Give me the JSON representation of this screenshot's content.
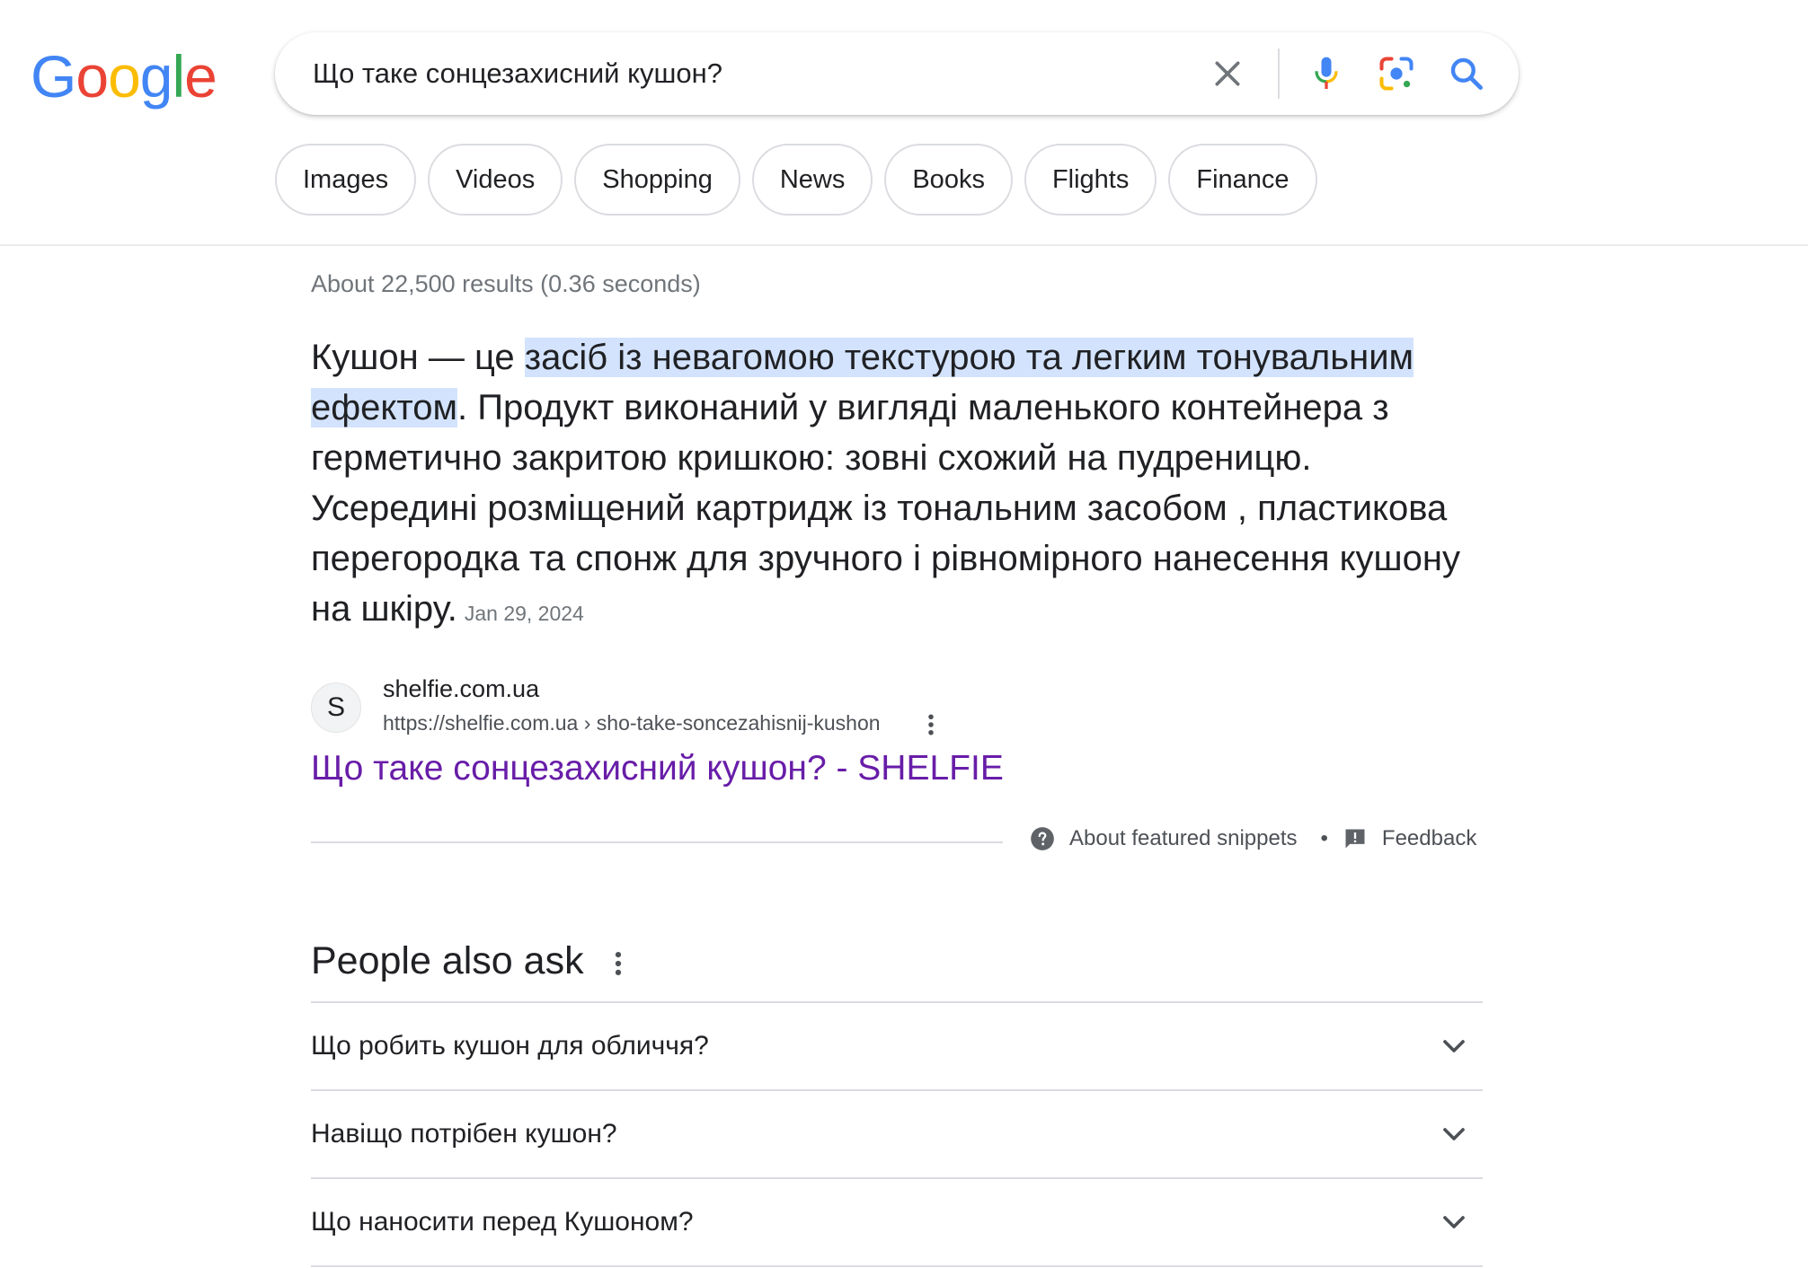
{
  "logo": {
    "letters": [
      "G",
      "o",
      "o",
      "g",
      "l",
      "e"
    ]
  },
  "search": {
    "query": "Що таке сонцезахисний кушон?",
    "icons": [
      "close-icon",
      "mic-icon",
      "lens-icon",
      "search-icon"
    ]
  },
  "chips": [
    "Images",
    "Videos",
    "Shopping",
    "News",
    "Books",
    "Flights",
    "Finance"
  ],
  "stats": "About 22,500 results (0.36 seconds)",
  "snippet": {
    "pre": "Кушон — це ",
    "highlight": "засіб із невагомою текстурою та легким тонувальним ефектом",
    "post": ". Продукт виконаний у вигляді маленького контейнера з герметично закритою кришкою: зовні схожий на пудреницю. Усередині розміщений картридж із тональним засобом , пластикова перегородка та спонж для зручного і рівномірного нанесення кушону на шкіру.",
    "date": "Jan 29, 2024"
  },
  "source": {
    "favicon_letter": "S",
    "site": "shelfie.com.ua",
    "url": "https://shelfie.com.ua › sho-take-soncezahisnij-kushon",
    "title": "Що таке сонцезахисний кушон? - SHELFIE"
  },
  "featured_footer": {
    "about": "About featured snippets",
    "separator": "•",
    "feedback": "Feedback"
  },
  "paa": {
    "heading": "People also ask",
    "items": [
      {
        "question": "Що робить кушон для обличчя?"
      },
      {
        "question": "Навіщо потрібен кушон?"
      },
      {
        "question": "Що наносити перед Кушоном?"
      }
    ]
  },
  "colors": {
    "link_visited": "#681da8",
    "highlight": "#d3e3fd",
    "google_blue": "#4285F4",
    "google_red": "#EA4335",
    "google_yellow": "#FBBC05",
    "google_green": "#34A853"
  }
}
